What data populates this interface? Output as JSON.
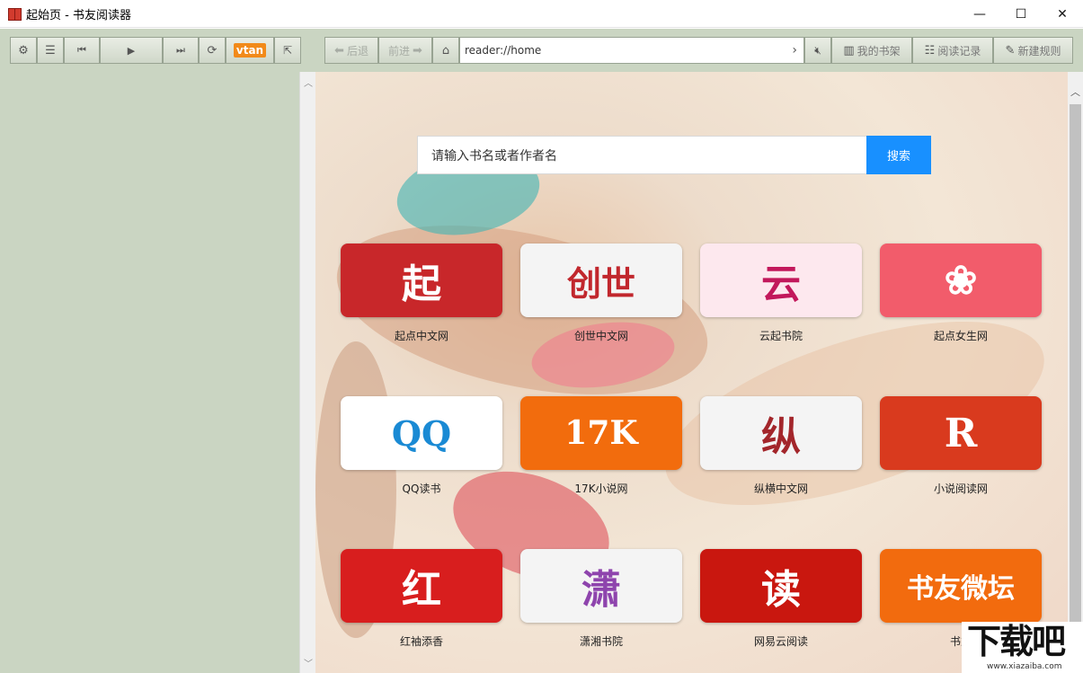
{
  "window": {
    "title": "起始页 - 书友阅读器",
    "controls": {
      "minimize": "—",
      "maximize": "☐",
      "close": "✕"
    }
  },
  "toolbar": {
    "settings_icon": "gear-icon",
    "menu_icon": "menu-icon",
    "vtan_label": "vtan",
    "back_label": "后退",
    "forward_label": "前进",
    "address": "reader://home",
    "bookshelf_label": "我的书架",
    "history_label": "阅读记录",
    "new_rule_label": "新建规则"
  },
  "search": {
    "placeholder": "请输入书名或者作者名",
    "button": "搜索"
  },
  "sites": [
    {
      "name": "起点中文网",
      "logo_text": "起",
      "bg": "#c8272a",
      "fg": "#ffffff"
    },
    {
      "name": "创世中文网",
      "logo_text": "创世",
      "bg": "#f4f4f4",
      "fg": "#c1272d"
    },
    {
      "name": "云起书院",
      "logo_text": "云",
      "bg": "#fde8ee",
      "fg": "#c2185b"
    },
    {
      "name": "起点女生网",
      "logo_text": "❀",
      "bg": "#f25c6b",
      "fg": "#ffffff"
    },
    {
      "name": "QQ读书",
      "logo_text": "QQ",
      "bg": "#ffffff",
      "fg": "#1a8ad4"
    },
    {
      "name": "17K小说网",
      "logo_text": "17K",
      "bg": "#f26c0d",
      "fg": "#ffffff"
    },
    {
      "name": "纵横中文网",
      "logo_text": "纵",
      "bg": "#f4f4f4",
      "fg": "#a3262b"
    },
    {
      "name": "小说阅读网",
      "logo_text": "R",
      "bg": "#d93a1e",
      "fg": "#ffffff"
    },
    {
      "name": "红袖添香",
      "logo_text": "红",
      "bg": "#d81e1e",
      "fg": "#ffffff"
    },
    {
      "name": "潇湘书院",
      "logo_text": "潇",
      "bg": "#f4f4f4",
      "fg": "#8e44ad"
    },
    {
      "name": "网易云阅读",
      "logo_text": "读",
      "bg": "#c9170f",
      "fg": "#ffffff"
    },
    {
      "name": "书友",
      "logo_text": "书友微坛",
      "bg": "#f26b0e",
      "fg": "#ffffff"
    }
  ],
  "watermark": {
    "main": "下载吧",
    "sub": "www.xiazaiba.com"
  }
}
